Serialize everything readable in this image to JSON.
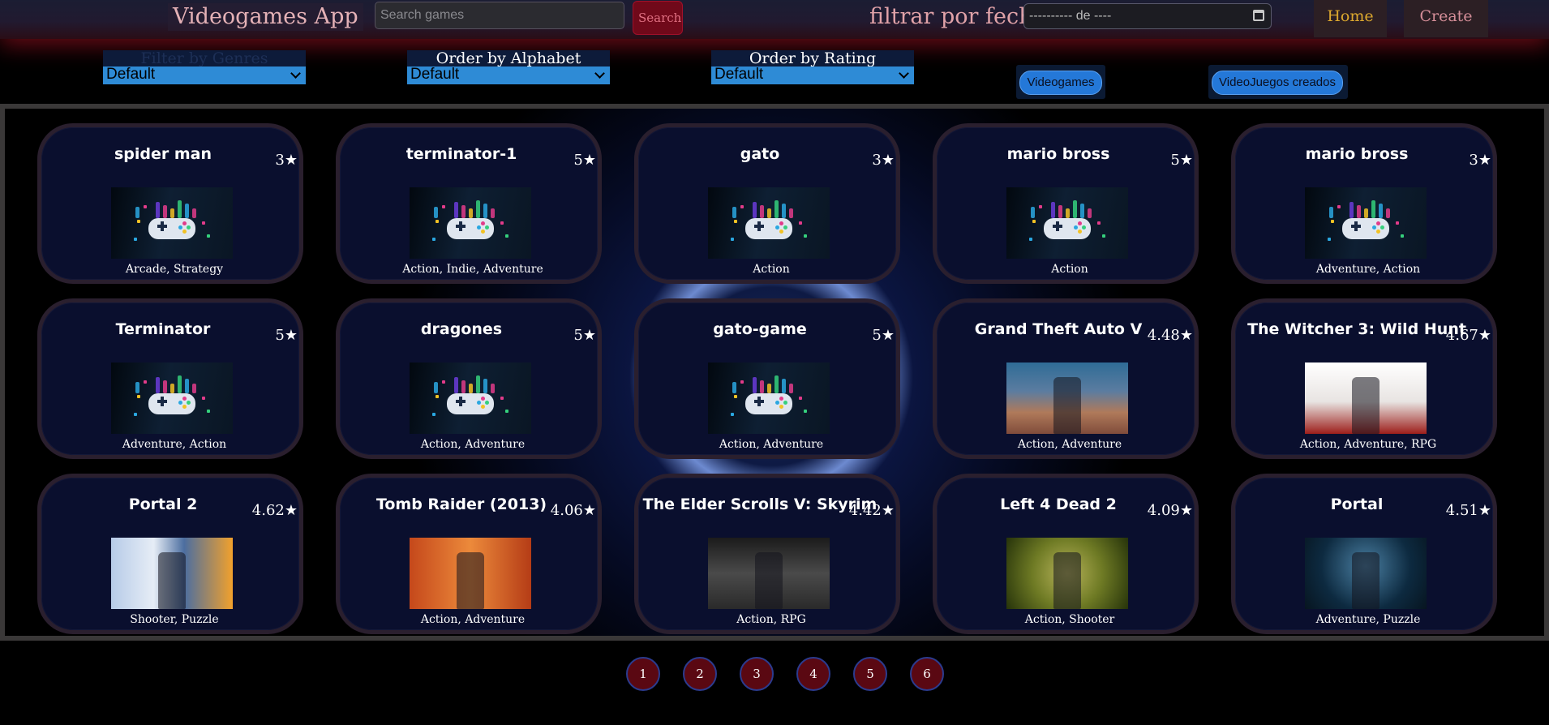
{
  "header": {
    "title": "Videogames App",
    "search_placeholder": "Search games",
    "search_button": "Search",
    "date_label": "filtrar por fecha",
    "date_value": "---------- de ----",
    "nav_home": "Home",
    "nav_create": "Create"
  },
  "filters": {
    "genres": {
      "label": "Filter by Genres",
      "value": "Default"
    },
    "alphabet": {
      "label": "Order by Alphabet",
      "value": "Default"
    },
    "rating": {
      "label": "Order by Rating",
      "value": "Default"
    },
    "btn_videogames": "Videogames",
    "btn_created": "VideoJuegos creados"
  },
  "games": [
    {
      "name": "spider man",
      "rating": "3★",
      "genres": "Arcade, Strategy",
      "art": "default"
    },
    {
      "name": "terminator-1",
      "rating": "5★",
      "genres": "Action, Indie, Adventure",
      "art": "default"
    },
    {
      "name": "gato",
      "rating": "3★",
      "genres": "Action",
      "art": "default"
    },
    {
      "name": "mario bross",
      "rating": "5★",
      "genres": "Action",
      "art": "default"
    },
    {
      "name": "mario bross",
      "rating": "3★",
      "genres": "Adventure, Action",
      "art": "default"
    },
    {
      "name": "Terminator",
      "rating": "5★",
      "genres": "Adventure, Action",
      "art": "default"
    },
    {
      "name": "dragones",
      "rating": "5★",
      "genres": "Action, Adventure",
      "art": "default"
    },
    {
      "name": "gato-game",
      "rating": "5★",
      "genres": "Action, Adventure",
      "art": "default"
    },
    {
      "name": "Grand Theft Auto V",
      "rating": "4.48★",
      "genres": "Action, Adventure",
      "art": "gta"
    },
    {
      "name": "The Witcher 3: Wild Hunt",
      "rating": "4.67★",
      "genres": "Action, Adventure, RPG",
      "art": "witcher"
    },
    {
      "name": "Portal 2",
      "rating": "4.62★",
      "genres": "Shooter, Puzzle",
      "art": "portal2"
    },
    {
      "name": "Tomb Raider (2013)",
      "rating": "4.06★",
      "genres": "Action, Adventure",
      "art": "tomb"
    },
    {
      "name": "The Elder Scrolls V: Skyrim",
      "rating": "4.42★",
      "genres": "Action, RPG",
      "art": "skyrim"
    },
    {
      "name": "Left 4 Dead 2",
      "rating": "4.09★",
      "genres": "Action, Shooter",
      "art": "l4d2"
    },
    {
      "name": "Portal",
      "rating": "4.51★",
      "genres": "Adventure, Puzzle",
      "art": "portal"
    }
  ],
  "pagination": [
    "1",
    "2",
    "3",
    "4",
    "5",
    "6"
  ],
  "colors": {
    "accent_home": "#dca82e",
    "select_bg": "#2e8bd6",
    "page_btn_bg": "#5a0812",
    "card_bg": "#0a0f2e"
  }
}
